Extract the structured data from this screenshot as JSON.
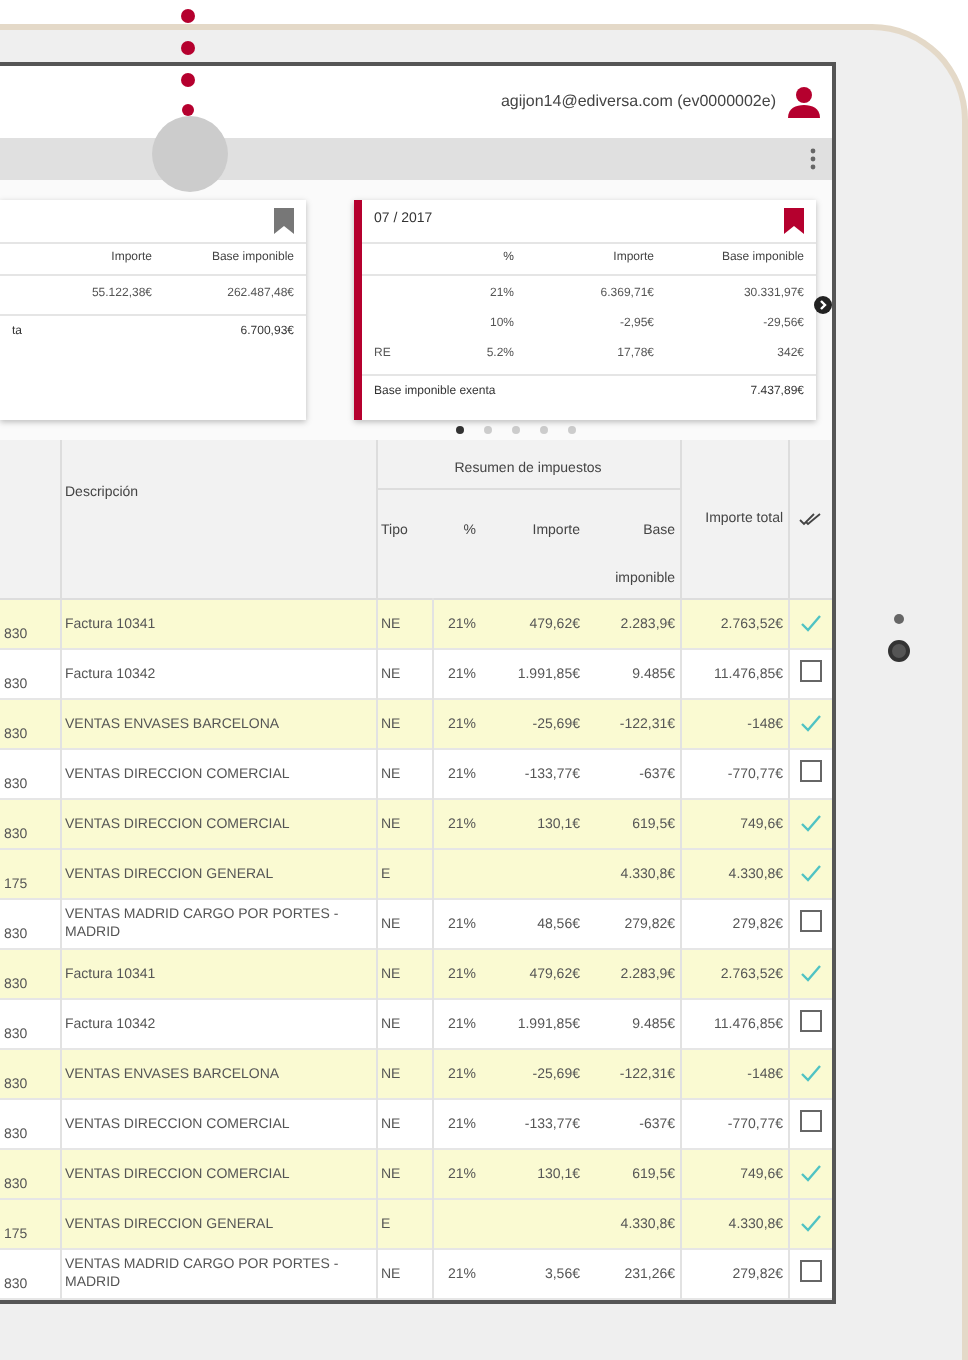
{
  "header": {
    "user": "agijon14@ediversa.com (ev0000002e)"
  },
  "cards": [
    {
      "selected": false,
      "columns": [
        "Importe",
        "Base imponible"
      ],
      "rows": [
        [
          "55.122,38€",
          "262.487,48€"
        ]
      ],
      "exempt": {
        "label": "ta",
        "value": "6.700,93€"
      }
    },
    {
      "selected": true,
      "title": "07 / 2017",
      "columns": [
        "",
        "%",
        "Importe",
        "Base imponible"
      ],
      "rows": [
        [
          "",
          "21%",
          "6.369,71€",
          "30.331,97€"
        ],
        [
          "",
          "10%",
          "-2,95€",
          "-29,56€"
        ],
        [
          "RE",
          "5.2%",
          "17,78€",
          "342€"
        ]
      ],
      "exempt": {
        "label": "Base imponible exenta",
        "value": "7.437,89€"
      }
    }
  ],
  "pager": [
    {
      "selected": true
    },
    {
      "selected": false
    },
    {
      "selected": false
    },
    {
      "selected": false
    },
    {
      "selected": false
    }
  ],
  "table": {
    "group_header": "Resumen de impuestos",
    "columns": [
      "Descripción",
      "Tipo",
      "%",
      "Importe",
      "Base imponible",
      "Importe total"
    ],
    "rows": [
      {
        "column_1": "830",
        "description": "Factura 10341",
        "tipo": "NE",
        "pct": "21%",
        "importe": "479,62€",
        "base": "2.283,9€",
        "total": "2.763,52€",
        "checked": true
      },
      {
        "column_1": "830",
        "description": "Factura 10342",
        "tipo": "NE",
        "pct": "21%",
        "importe": "1.991,85€",
        "base": "9.485€",
        "total": "11.476,85€",
        "checked": false
      },
      {
        "column_1": "830",
        "description": "VENTAS ENVASES BARCELONA",
        "tipo": "NE",
        "pct": "21%",
        "importe": "-25,69€",
        "base": "-122,31€",
        "total": "-148€",
        "checked": true
      },
      {
        "column_1": "830",
        "description": "VENTAS DIRECCION COMERCIAL",
        "tipo": "NE",
        "pct": "21%",
        "importe": "-133,77€",
        "base": "-637€",
        "total": "-770,77€",
        "checked": false
      },
      {
        "column_1": "830",
        "description": "VENTAS DIRECCION COMERCIAL",
        "tipo": "NE",
        "pct": "21%",
        "importe": "130,1€",
        "base": "619,5€",
        "total": "749,6€",
        "checked": true
      },
      {
        "column_1": "175",
        "description": "VENTAS DIRECCION GENERAL",
        "tipo": "E",
        "base": "4.330,8€",
        "total": "4.330,8€",
        "checked": true
      },
      {
        "column_1": "830",
        "description": "VENTAS MADRID CARGO POR PORTES - MADRID",
        "tipo": "NE",
        "pct": "21%",
        "importe": "48,56€",
        "base": "279,82€",
        "total": "279,82€",
        "checked": false
      },
      {
        "column_1": "830",
        "description": "Factura 10341",
        "tipo": "NE",
        "pct": "21%",
        "importe": "479,62€",
        "base": "2.283,9€",
        "total": "2.763,52€",
        "checked": true
      },
      {
        "column_1": "830",
        "description": "Factura 10342",
        "tipo": "NE",
        "pct": "21%",
        "importe": "1.991,85€",
        "base": "9.485€",
        "total": "11.476,85€",
        "checked": false
      },
      {
        "column_1": "830",
        "description": "VENTAS ENVASES BARCELONA",
        "tipo": "NE",
        "pct": "21%",
        "importe": "-25,69€",
        "base": "-122,31€",
        "total": "-148€",
        "checked": true
      },
      {
        "column_1": "830",
        "description": "VENTAS DIRECCION COMERCIAL",
        "tipo": "NE",
        "pct": "21%",
        "importe": "-133,77€",
        "base": "-637€",
        "total": "-770,77€",
        "checked": false
      },
      {
        "column_1": "830",
        "description": "VENTAS DIRECCION COMERCIAL",
        "tipo": "NE",
        "pct": "21%",
        "importe": "130,1€",
        "base": "619,5€",
        "total": "749,6€",
        "checked": true
      },
      {
        "column_1": "175",
        "description": "VENTAS DIRECCION GENERAL",
        "tipo": "E",
        "base": "4.330,8€",
        "total": "4.330,8€",
        "checked": true
      },
      {
        "column_1": "830",
        "description": "VENTAS MADRID CARGO POR PORTES - MADRID",
        "tipo": "NE",
        "pct": "21%",
        "importe": "3,56€",
        "base": "231,26€",
        "total": "279,82€",
        "checked": false
      }
    ]
  }
}
